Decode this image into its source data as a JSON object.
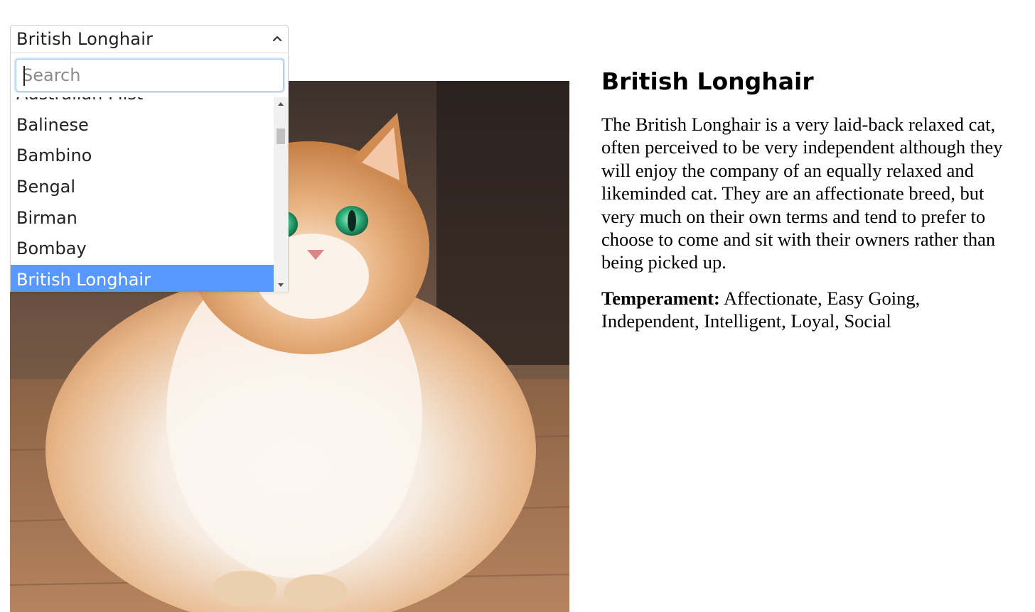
{
  "select": {
    "selected_value": "British Longhair",
    "search_placeholder": "Search",
    "options": [
      "Australian Mist",
      "Balinese",
      "Bambino",
      "Bengal",
      "Birman",
      "Bombay",
      "British Longhair"
    ],
    "selected_index": 6,
    "highlight_color": "#5897fb"
  },
  "breed": {
    "name": "British Longhair",
    "description": "The British Longhair is a very laid-back relaxed cat, often perceived to be very independent although they will enjoy the company of an equally relaxed and likeminded cat. They are an affectionate breed, but very much on their own terms and tend to prefer to choose to come and sit with their owners rather than being picked up.",
    "temperament_label": "Temperament:",
    "temperament": "Affectionate, Easy Going, Independent, Intelligent, Loyal, Social"
  },
  "icons": {
    "select_toggle": "chevron-up-icon",
    "scroll_up": "triangle-up-icon",
    "scroll_down": "triangle-down-icon"
  }
}
